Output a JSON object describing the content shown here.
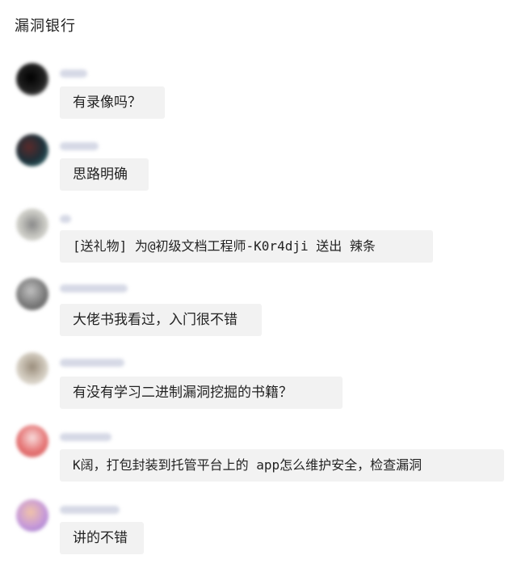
{
  "header": {
    "title": "漏洞银行"
  },
  "messages": [
    {
      "text": "有录像吗？",
      "avatar_color": "#1a1a1a"
    },
    {
      "text": "思路明确",
      "avatar_color": "#2c3e4a"
    },
    {
      "text": "[送礼物] 为@初级文档工程师-K0r4dji 送出 辣条",
      "avatar_color": "#b7b7b2"
    },
    {
      "text": "大佬书我看过，入门很不错",
      "avatar_color": "#8a8a8a"
    },
    {
      "text": "有没有学习二进制漏洞挖掘的书籍？",
      "avatar_color": "#c9c1b3"
    },
    {
      "text": "K阔，打包封装到托管平台上的 app怎么维护安全，检查漏洞",
      "avatar_color": "#e77b7b"
    },
    {
      "text": "讲的不错",
      "avatar_color": "#b592d4"
    }
  ]
}
